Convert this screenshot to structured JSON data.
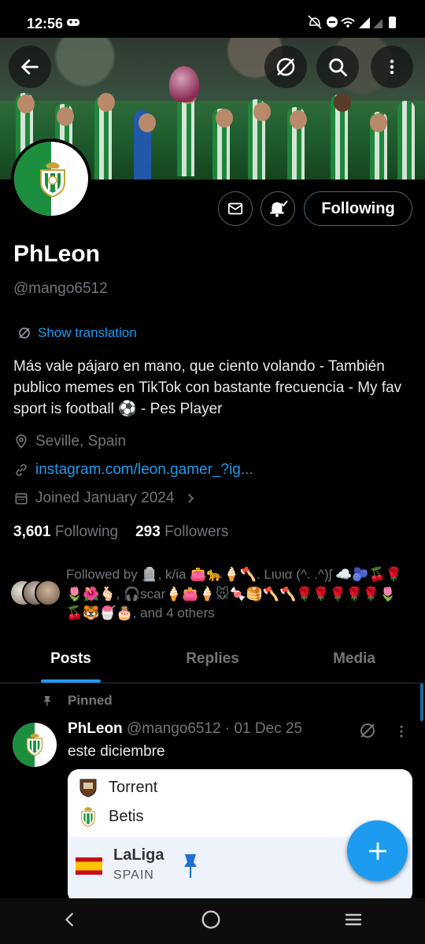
{
  "status_bar": {
    "time": "12:56"
  },
  "profile": {
    "name": "PhLeon",
    "handle": "@mango6512",
    "show_translation": "Show translation",
    "bio": "Más vale pájaro en mano, que ciento volando - También publico memes en TikTok con bastante frecuencia - My fav sport is football ⚽ - Pes Player",
    "location": "Seville, Spain",
    "website": "instagram.com/leon.gamer_?ig...",
    "joined": "Joined January 2024",
    "following_count": "3,601",
    "following_label": "Following",
    "followers_count": "293",
    "followers_label": "Followers",
    "followed_by": "Followed by 🪦, k/ia 👛🐆🍦🪓. Lιυια (^. .^)ʃ ☁️🫐🍒🌹🌷🌺🫰🏻, 🎧scar🍦👛🍦🐭🍬🥞🪓🪓🌹🌹🌹🌹🌹🌷🍒🐯🍧🎂, and 4 others"
  },
  "buttons": {
    "follow_state": "Following"
  },
  "tabs": [
    {
      "label": "Posts",
      "active": true
    },
    {
      "label": "Replies",
      "active": false
    },
    {
      "label": "Media",
      "active": false
    }
  ],
  "pinned_post": {
    "pinned_label": "Pinned",
    "author": "PhLeon",
    "handle_date": "@mango6512 · 01 Dec 25",
    "text": "este diciembre",
    "card": {
      "team_home": "Torrent",
      "team_away": "Betis",
      "league": "LaLiga",
      "country": "SPAIN"
    }
  },
  "colors": {
    "accent": "#1d9bf0",
    "betis_green": "#1c8f3f",
    "background": "#000000"
  }
}
